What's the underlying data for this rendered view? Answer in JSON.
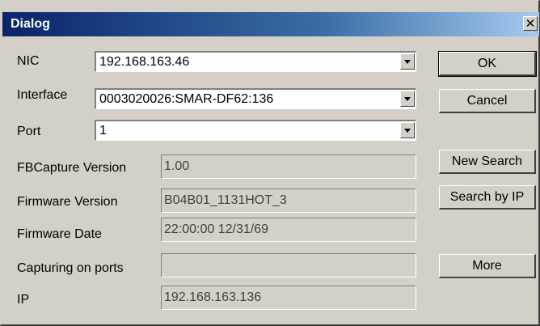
{
  "window": {
    "title": "Dialog",
    "close_glyph": "✕"
  },
  "form": {
    "nic": {
      "label": "NIC",
      "value": "192.168.163.46"
    },
    "interface": {
      "label": "Interface",
      "value": "0003020026:SMAR-DF62:136"
    },
    "port": {
      "label": "Port",
      "value": "1"
    },
    "fbcapture_version": {
      "label": "FBCapture Version",
      "value": "1.00"
    },
    "firmware_version": {
      "label": "Firmware Version",
      "value": "B04B01_1131HOT_3"
    },
    "firmware_date": {
      "label": "Firmware Date",
      "value": "22:00:00 12/31/69"
    },
    "capturing_on_ports": {
      "label": "Capturing on ports",
      "value": ""
    },
    "ip": {
      "label": "IP",
      "value": "192.168.163.136"
    }
  },
  "buttons": {
    "ok": "OK",
    "cancel": "Cancel",
    "new_search": "New Search",
    "search_by_ip": "Search by IP",
    "more": "More"
  }
}
